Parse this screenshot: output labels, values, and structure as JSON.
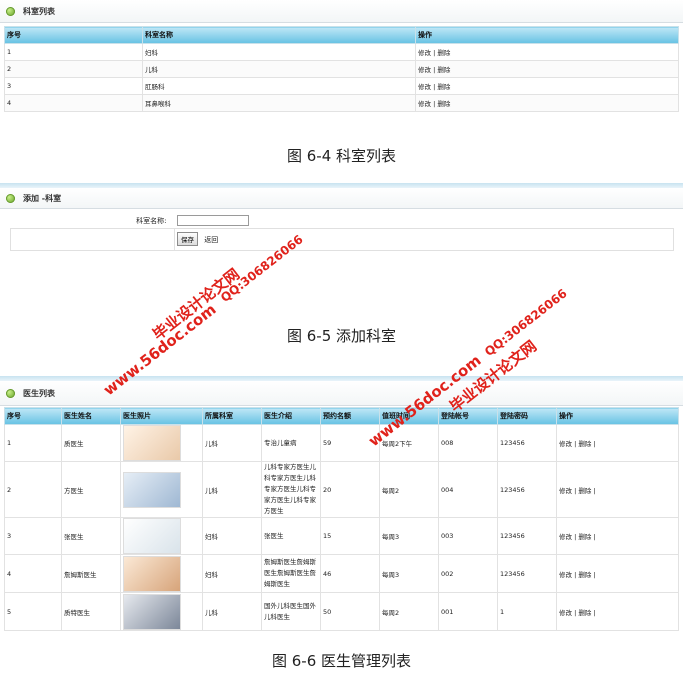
{
  "dept_list": {
    "title": "科室列表",
    "columns": [
      "序号",
      "科室名称",
      "操作"
    ],
    "rows": [
      {
        "id": "1",
        "name": "妇科",
        "ops": "修改 | 删除"
      },
      {
        "id": "2",
        "name": "儿科",
        "ops": "修改 | 删除"
      },
      {
        "id": "3",
        "name": "肛肠科",
        "ops": "修改 | 删除"
      },
      {
        "id": "4",
        "name": "耳鼻喉科",
        "ops": "修改 | 删除"
      }
    ]
  },
  "caption1": "图 6-4 科室列表",
  "add_dept": {
    "title": "添加 -科室",
    "label": "科室名称:",
    "input_value": "",
    "save_label": "保存",
    "back_label": "返回"
  },
  "caption2": "图 6-5 添加科室",
  "doctor_list": {
    "title": "医生列表",
    "columns": [
      "序号",
      "医生姓名",
      "医生照片",
      "所属科室",
      "医生介绍",
      "预约名额",
      "值班时间",
      "登陆帐号",
      "登陆密码",
      "操作"
    ],
    "rows": [
      {
        "id": "1",
        "name": "质医生",
        "dept": "儿科",
        "intro": "专治儿童病",
        "quota": "59",
        "time": "每周2下午",
        "account": "008",
        "password": "123456",
        "ops": "修改 | 删除 |"
      },
      {
        "id": "2",
        "name": "方医生",
        "dept": "儿科",
        "intro": "儿科专家方医生儿科专家方医生儿科专家方医生儿科专家方医生儿科专家方医生",
        "quota": "20",
        "time": "每周2",
        "account": "004",
        "password": "123456",
        "ops": "修改 | 删除 |"
      },
      {
        "id": "3",
        "name": "张医生",
        "dept": "妇科",
        "intro": "张医生",
        "quota": "15",
        "time": "每周3",
        "account": "003",
        "password": "123456",
        "ops": "修改 | 删除 |"
      },
      {
        "id": "4",
        "name": "詹姆斯医生",
        "dept": "妇科",
        "intro": "詹姆斯医生詹姆斯医生詹姆斯医生詹姆斯医生",
        "quota": "46",
        "time": "每周3",
        "account": "002",
        "password": "123456",
        "ops": "修改 | 删除 |"
      },
      {
        "id": "5",
        "name": "质特医生",
        "dept": "儿科",
        "intro": "国外儿科医生国外儿科医生",
        "quota": "50",
        "time": "每周2",
        "account": "001",
        "password": "1",
        "ops": "修改 | 删除 |"
      }
    ]
  },
  "caption3": "图 6-6 医生管理列表",
  "watermarks": {
    "site": "www.56doc.com",
    "name": "毕业设计论文网",
    "qq": "QQ:306826066"
  },
  "colors": {
    "header_blue": "#66c2e3",
    "watermark_red": "#e0221b",
    "icon_green": "#5b9a1d"
  }
}
